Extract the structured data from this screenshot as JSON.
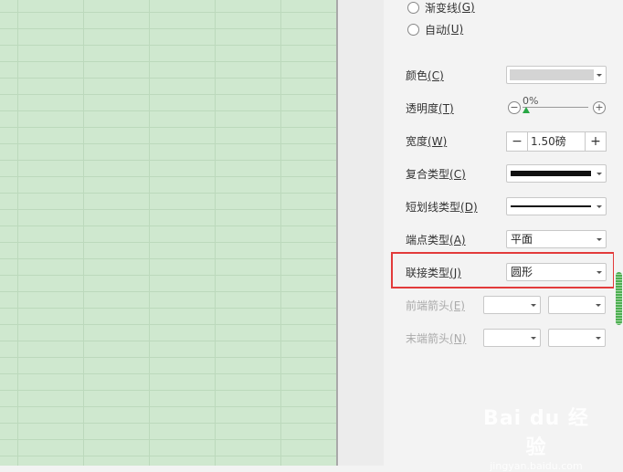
{
  "panel": {
    "radios": [
      {
        "label": "渐变线",
        "key": "(G)"
      },
      {
        "label": "自动",
        "key": "(U)"
      }
    ],
    "color_label": "颜色",
    "color_key": "(C)",
    "transparency_label": "透明度",
    "transparency_key": "(T)",
    "transparency_value": "0%",
    "width_label": "宽度",
    "width_key": "(W)",
    "width_value": "1.50磅",
    "compound_label": "复合类型",
    "compound_key": "(C)",
    "dash_label": "短划线类型",
    "dash_key": "(D)",
    "cap_label": "端点类型",
    "cap_key": "(A)",
    "cap_value": "平面",
    "join_label": "联接类型",
    "join_key": "(J)",
    "join_value": "圆形",
    "begin_arrow_label": "前端箭头",
    "begin_arrow_key": "(E)",
    "end_arrow_label": "末端箭头",
    "end_arrow_key": "(N)",
    "minus": "−",
    "plus": "+"
  },
  "watermark": {
    "logo": "Bai du 经验",
    "url": "jingyan.baidu.com"
  },
  "colors": {
    "highlight": "#e23b3b",
    "slider": "#28a745",
    "scroll_thumb": "#4caf50",
    "sheet": "#cfe8cf"
  }
}
